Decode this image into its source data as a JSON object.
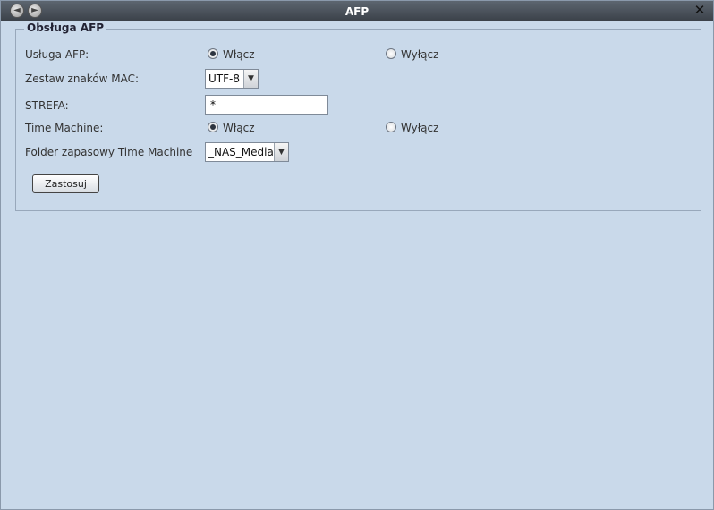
{
  "window": {
    "title": "AFP",
    "nav_back_glyph": "◄",
    "nav_forward_glyph": "►",
    "close_glyph": "✕"
  },
  "section": {
    "legend": "Obsługa AFP"
  },
  "form": {
    "afp_service": {
      "label": "Usługa AFP:",
      "options": [
        {
          "label": "Włącz",
          "checked": true
        },
        {
          "label": "Wyłącz",
          "checked": false
        }
      ]
    },
    "mac_charset": {
      "label": "Zestaw znaków MAC:",
      "value": "UTF-8"
    },
    "zone": {
      "label": "STREFA:",
      "value": "*"
    },
    "time_machine": {
      "label": "Time Machine:",
      "options": [
        {
          "label": "Włącz",
          "checked": true
        },
        {
          "label": "Wyłącz",
          "checked": false
        }
      ]
    },
    "tm_backup_folder": {
      "label": "Folder zapasowy Time Machine",
      "value": "_NAS_Media"
    },
    "apply_label": "Zastosuj"
  },
  "icons": {
    "back": "arrow-left-icon",
    "forward": "arrow-right-icon",
    "close": "close-icon",
    "dropdown": "chevron-down-icon"
  },
  "colors": {
    "background": "#c9d9ea",
    "titlebar": "#4a5159"
  }
}
